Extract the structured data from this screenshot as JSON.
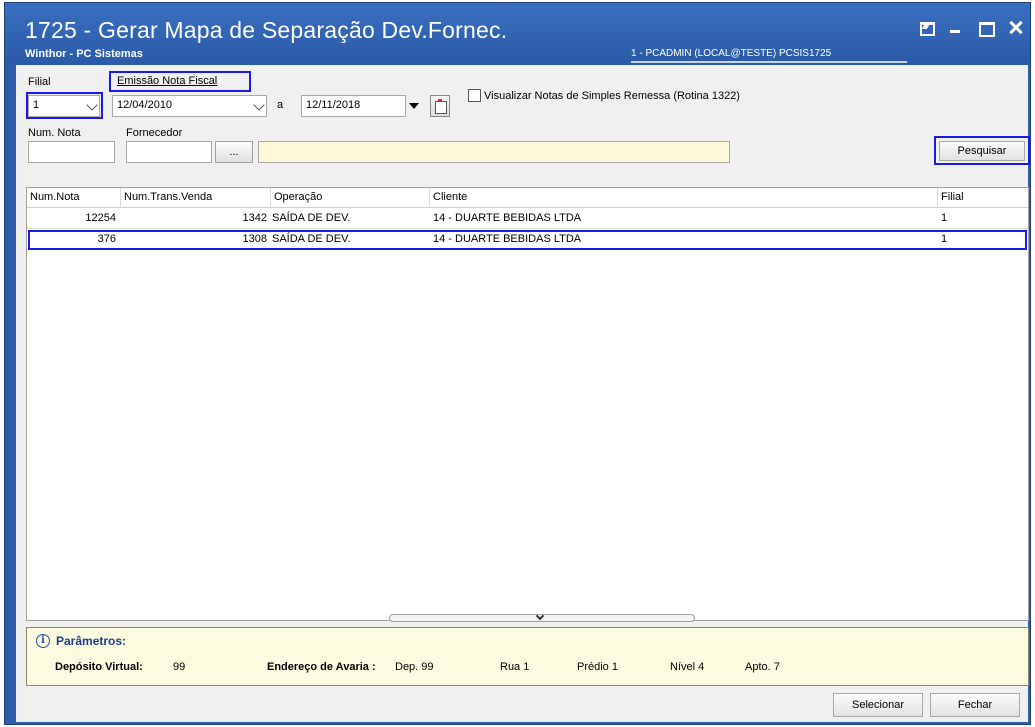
{
  "window": {
    "title": "1725 - Gerar Mapa de Separação Dev.Fornec.",
    "subtitle": "Winthor - PC Sistemas",
    "session_info": "1 - PCADMIN (LOCAL@TESTE)  PCSIS1725"
  },
  "filters": {
    "filial_label": "Filial",
    "filial_value": "1",
    "emissao_label": "Emissão Nota Fiscal",
    "date_from": "12/04/2010",
    "date_separator": "a",
    "date_to": "12/11/2018",
    "simples_remessa_label": "Visualizar Notas de Simples Remessa (Rotina 1322)",
    "simples_remessa_checked": false,
    "num_nota_label": "Num. Nota",
    "num_nota_value": "",
    "fornecedor_label": "Fornecedor",
    "fornecedor_code": "",
    "fornecedor_lookup_label": "...",
    "fornecedor_name": "",
    "pesquisar_label": "Pesquisar"
  },
  "grid": {
    "columns": [
      "Num.Nota",
      "Num.Trans.Venda",
      "Operação",
      "Cliente",
      "Filial"
    ],
    "rows": [
      {
        "num_nota": "12254",
        "num_trans": "1342",
        "operacao": "SAÍDA DE DEV.",
        "cliente": "14 - DUARTE BEBIDAS LTDA",
        "filial": "1"
      },
      {
        "num_nota": "376",
        "num_trans": "1308",
        "operacao": "SAÍDA DE DEV.",
        "cliente": "14 - DUARTE BEBIDAS LTDA",
        "filial": "1"
      }
    ],
    "selected_row": 1
  },
  "params": {
    "title": "Parâmetros:",
    "deposito_label": "Depósito Virtual:",
    "deposito_value": "99",
    "endereco_label": "Endereço de Avaria :",
    "dep": "Dep. 99",
    "rua": "Rua 1",
    "predio": "Prédio 1",
    "nivel": "Nível 4",
    "apto": "Apto. 7"
  },
  "footer": {
    "selecionar_label": "Selecionar",
    "fechar_label": "Fechar"
  },
  "colors": {
    "title_bar": "#2f5ea8",
    "highlight": "#1a1ae6",
    "params_bg": "#fbfbe0",
    "fornecedor_name_bg": "#fcf8d8"
  }
}
